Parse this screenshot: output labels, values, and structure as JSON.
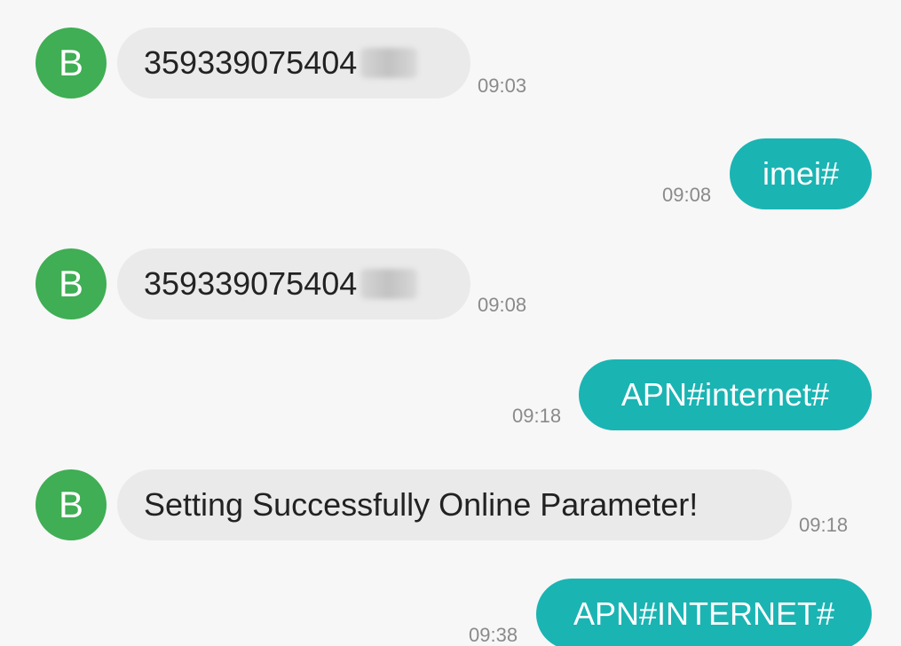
{
  "messages": [
    {
      "direction": "incoming",
      "avatar_letter": "B",
      "text": "359339075404",
      "time": "09:03"
    },
    {
      "direction": "outgoing",
      "text": "imei#",
      "time": "09:08"
    },
    {
      "direction": "incoming",
      "avatar_letter": "B",
      "text": "359339075404",
      "time": "09:08"
    },
    {
      "direction": "outgoing",
      "text": "APN#internet#",
      "time": "09:18"
    },
    {
      "direction": "incoming",
      "avatar_letter": "B",
      "text": "Setting Successfully Online Parameter!",
      "time": "09:18"
    },
    {
      "direction": "outgoing",
      "text": "APN#INTERNET#",
      "time": "09:38"
    }
  ],
  "colors": {
    "avatar": "#3fae54",
    "incoming_bubble": "#eaeaea",
    "outgoing_bubble": "#1ab4b3",
    "background": "#f7f7f7"
  }
}
